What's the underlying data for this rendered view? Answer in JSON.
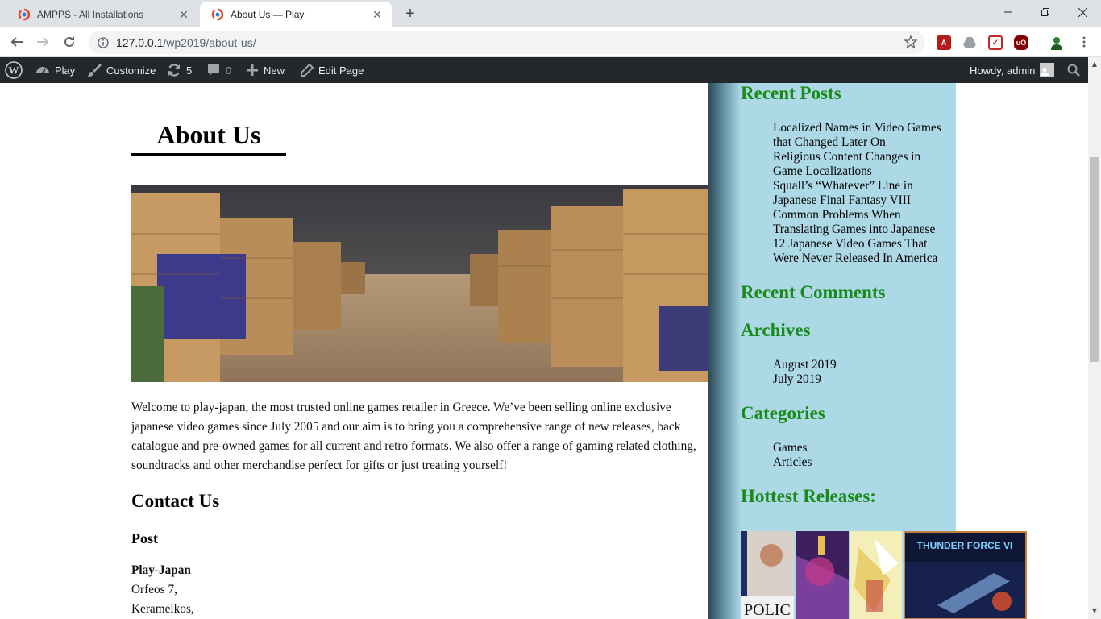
{
  "browser": {
    "tabs": [
      {
        "title": "AMPPS - All Installations",
        "active": false
      },
      {
        "title": "About Us — Play",
        "active": true
      }
    ],
    "new_tab_icon": "plus-icon",
    "window_controls": [
      "minimize-icon",
      "restore-icon",
      "close-icon"
    ],
    "url_host": "127.0.0.1",
    "url_path": "/wp2019/about-us/",
    "extensions": [
      "pdf-icon",
      "drive-icon",
      "pocket-icon",
      "ublock-icon",
      "profile-icon"
    ]
  },
  "adminbar": {
    "site_name": "Play",
    "customize": "Customize",
    "updates_count": "5",
    "comments_count": "0",
    "new_label": "New",
    "edit_label": "Edit Page",
    "howdy": "Howdy, admin",
    "bg_color": "#23282d"
  },
  "page": {
    "title": "About Us",
    "intro": "Welcome to play-japan, the most trusted online games retailer in Greece. We’ve been selling online exclusive japanese video games since July 2005 and our aim is to bring you a comprehensive range of new releases, back catalogue and pre-owned games for all current and retro formats. We also offer a range of gaming related clothing, soundtracks and other merchandise perfect for gifts or just treating yourself!",
    "contact_heading": "Contact Us",
    "post_heading": "Post",
    "address": {
      "company": "Play-Japan",
      "street": "Orfeos 7,",
      "area": "Kerameikos,"
    }
  },
  "sidebar": {
    "bg_color": "#add8e6",
    "heading_color": "#1a8a1a",
    "recent_posts_heading": "Recent Posts",
    "recent_posts": [
      "Localized Names in Video Games that Changed Later On",
      "Religious Content Changes in Game Localizations",
      "Squall’s “Whatever” Line in Japanese Final Fantasy VIII",
      "Common Problems When Translating Games into Japanese",
      "12 Japanese Video Games That Were Never Released In America"
    ],
    "recent_comments_heading": "Recent Comments",
    "archives_heading": "Archives",
    "archives": [
      "August 2019",
      "July 2019"
    ],
    "categories_heading": "Categories",
    "categories": [
      "Games",
      "Articles"
    ],
    "hottest_heading": "Hottest Releases:",
    "cover_text_police": "POLIC",
    "cover_text_thunder": "THUNDER FORCE VI"
  }
}
